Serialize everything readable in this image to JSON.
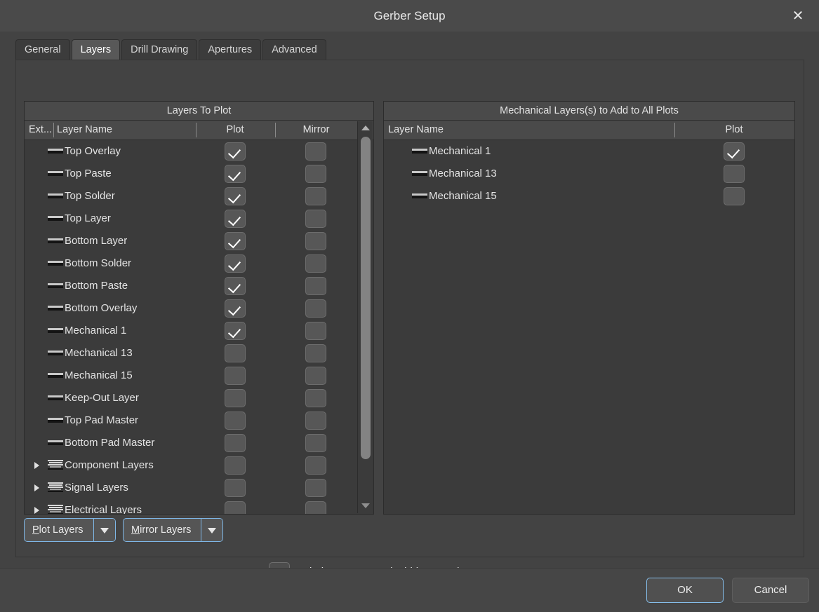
{
  "window": {
    "title": "Gerber Setup",
    "close_icon": "close-icon"
  },
  "tabs": [
    {
      "label": "General",
      "active": false
    },
    {
      "label": "Layers",
      "active": true
    },
    {
      "label": "Drill Drawing",
      "active": false
    },
    {
      "label": "Apertures",
      "active": false
    },
    {
      "label": "Advanced",
      "active": false
    }
  ],
  "left_panel": {
    "caption": "Layers To Plot",
    "columns": {
      "ext": "Ext...",
      "layer_name": "Layer Name",
      "plot": "Plot",
      "mirror": "Mirror"
    },
    "rows": [
      {
        "name": "Top Overlay",
        "icon": "layer-color-swatch-icon",
        "group": false,
        "plot": true,
        "mirror": false
      },
      {
        "name": "Top Paste",
        "icon": "layer-color-swatch-icon",
        "group": false,
        "plot": true,
        "mirror": false
      },
      {
        "name": "Top Solder",
        "icon": "layer-color-swatch-icon",
        "group": false,
        "plot": true,
        "mirror": false
      },
      {
        "name": "Top Layer",
        "icon": "layer-color-swatch-icon",
        "group": false,
        "plot": true,
        "mirror": false
      },
      {
        "name": "Bottom Layer",
        "icon": "layer-color-swatch-icon",
        "group": false,
        "plot": true,
        "mirror": false
      },
      {
        "name": "Bottom Solder",
        "icon": "layer-color-swatch-icon",
        "group": false,
        "plot": true,
        "mirror": false
      },
      {
        "name": "Bottom Paste",
        "icon": "layer-color-swatch-icon",
        "group": false,
        "plot": true,
        "mirror": false
      },
      {
        "name": "Bottom Overlay",
        "icon": "layer-color-swatch-icon",
        "group": false,
        "plot": true,
        "mirror": false
      },
      {
        "name": "Mechanical 1",
        "icon": "layer-color-swatch-icon",
        "group": false,
        "plot": true,
        "mirror": false
      },
      {
        "name": "Mechanical 13",
        "icon": "layer-color-swatch-icon",
        "group": false,
        "plot": false,
        "mirror": false
      },
      {
        "name": "Mechanical 15",
        "icon": "layer-color-swatch-icon",
        "group": false,
        "plot": false,
        "mirror": false
      },
      {
        "name": "Keep-Out Layer",
        "icon": "layer-color-swatch-icon",
        "group": false,
        "plot": false,
        "mirror": false
      },
      {
        "name": "Top Pad Master",
        "icon": "layer-color-swatch-icon",
        "group": false,
        "plot": false,
        "mirror": false
      },
      {
        "name": "Bottom Pad Master",
        "icon": "layer-color-swatch-icon",
        "group": false,
        "plot": false,
        "mirror": false
      },
      {
        "name": "Component Layers",
        "icon": "layer-stack-icon",
        "group": true,
        "plot": false,
        "mirror": false
      },
      {
        "name": "Signal Layers",
        "icon": "layer-stack-icon",
        "group": true,
        "plot": false,
        "mirror": false
      },
      {
        "name": "Electrical Layers",
        "icon": "layer-stack-icon",
        "group": true,
        "plot": false,
        "mirror": false
      }
    ],
    "scrollbar": {
      "up_icon": "scroll-up-arrow-icon",
      "down_icon": "scroll-down-arrow-icon"
    }
  },
  "right_panel": {
    "caption": "Mechanical Layers(s) to Add to All Plots",
    "columns": {
      "layer_name": "Layer Name",
      "plot": "Plot"
    },
    "rows": [
      {
        "name": "Mechanical 1",
        "icon": "layer-color-swatch-icon",
        "plot": true
      },
      {
        "name": "Mechanical 13",
        "icon": "layer-color-swatch-icon",
        "plot": false
      },
      {
        "name": "Mechanical 15",
        "icon": "layer-color-swatch-icon",
        "plot": false
      }
    ]
  },
  "bottom_controls": {
    "plot_layers": {
      "label": "Plot Layers",
      "accel": "P",
      "dropdown_icon": "chevron-down-icon"
    },
    "mirror_layers": {
      "label": "Mirror Layers",
      "accel": "M",
      "dropdown_icon": "chevron-down-icon"
    },
    "include_pads": {
      "label": "Include unconnected mid-layer pads",
      "accel": "I",
      "checked": true
    }
  },
  "footer": {
    "ok": "OK",
    "cancel": "Cancel"
  },
  "colors": {
    "titlebar_bg": "#4a4a4a",
    "dialog_bg": "#434343",
    "list_bg": "#3b3b3b",
    "header_bg": "#4a4a4a",
    "accent_focus": "#85bdea",
    "text": "#e4e4e4"
  }
}
